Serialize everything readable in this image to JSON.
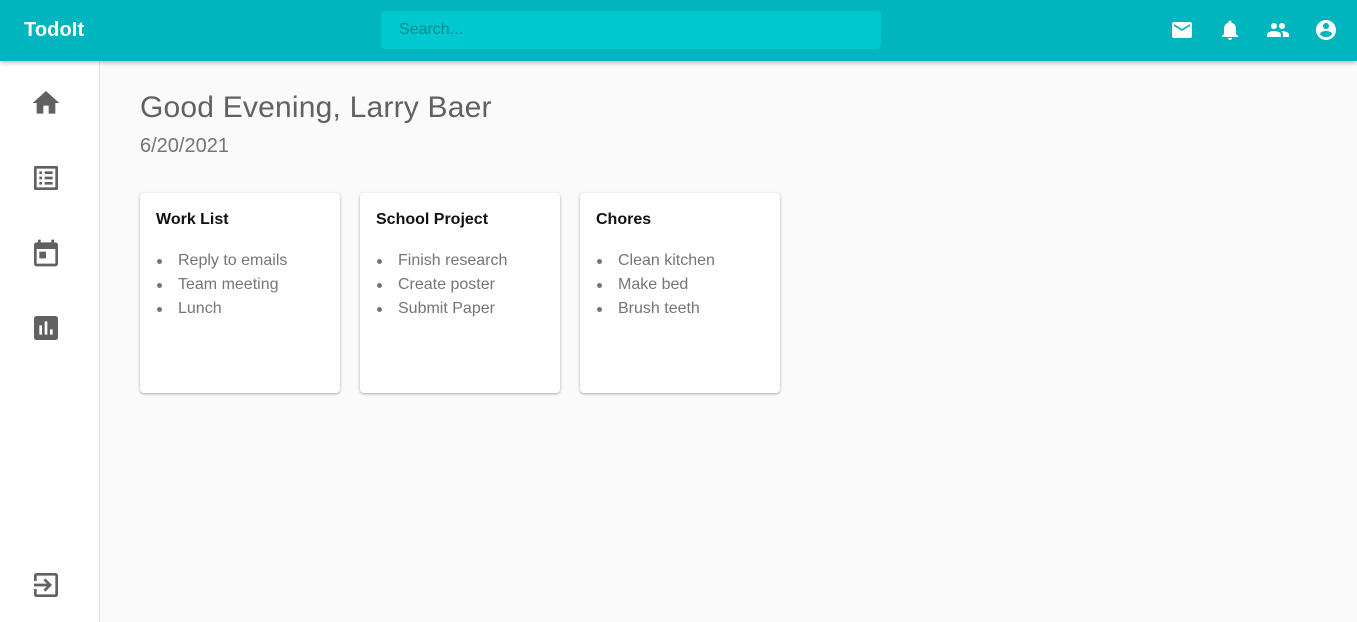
{
  "app": {
    "title": "TodoIt"
  },
  "search": {
    "placeholder": "Search..."
  },
  "topbar": {
    "icons": [
      "mail-icon",
      "bell-icon",
      "people-icon",
      "account-circle-icon"
    ]
  },
  "sidebar": {
    "icons": [
      "home-icon",
      "list-icon",
      "calendar-icon",
      "chart-icon"
    ],
    "bottom_icon": "logout-icon"
  },
  "main": {
    "greeting": "Good Evening, Larry Baer",
    "date": "6/20/2021",
    "cards": [
      {
        "title": "Work List",
        "items": [
          "Reply to emails",
          "Team meeting",
          "Lunch"
        ]
      },
      {
        "title": "School Project",
        "items": [
          "Finish research",
          "Create poster",
          "Submit Paper"
        ]
      },
      {
        "title": "Chores",
        "items": [
          "Clean kitchen",
          "Make bed",
          "Brush teeth"
        ]
      }
    ]
  },
  "colors": {
    "primary": "#00b5bd",
    "search_bg": "#00c8cf",
    "icon_gray": "#616161",
    "background": "#fafafa"
  }
}
